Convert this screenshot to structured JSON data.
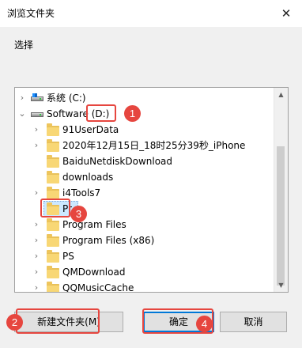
{
  "window": {
    "title": "浏览文件夹",
    "close_glyph": "✕"
  },
  "prompt": "选择",
  "tree": {
    "items": [
      {
        "label": "系统 (C:)",
        "expander": "›",
        "icon": "system-drive-icon"
      },
      {
        "label": "Software (D:)",
        "expander": "⌄",
        "icon": "drive-icon"
      },
      {
        "label": "91UserData",
        "expander": "›",
        "icon": "folder-icon"
      },
      {
        "label": "2020年12月15日_18时25分39秒_iPhone",
        "expander": "›",
        "icon": "folder-icon"
      },
      {
        "label": "BaiduNetdiskDownload",
        "expander": "",
        "icon": "folder-icon"
      },
      {
        "label": "downloads",
        "expander": "",
        "icon": "folder-icon"
      },
      {
        "label": "i4Tools7",
        "expander": "›",
        "icon": "folder-icon"
      },
      {
        "label": "Pr",
        "expander": "",
        "icon": "folder-icon"
      },
      {
        "label": "Program Files",
        "expander": "›",
        "icon": "folder-icon"
      },
      {
        "label": "Program Files (x86)",
        "expander": "›",
        "icon": "folder-icon"
      },
      {
        "label": "PS",
        "expander": "›",
        "icon": "folder-icon"
      },
      {
        "label": "QMDownload",
        "expander": "›",
        "icon": "folder-icon"
      },
      {
        "label": "QQMusicCache",
        "expander": "›",
        "icon": "folder-icon"
      }
    ],
    "scroll_up_glyph": "▲",
    "scroll_down_glyph": "▼"
  },
  "buttons": {
    "new_folder": "新建文件夹(M)",
    "ok": "确定",
    "cancel": "取消"
  },
  "annotations": [
    "1",
    "2",
    "3",
    "4"
  ],
  "colors": {
    "annotation_red": "#e6463f",
    "selection": "#cce8ff",
    "focus_blue": "#0078d7"
  }
}
